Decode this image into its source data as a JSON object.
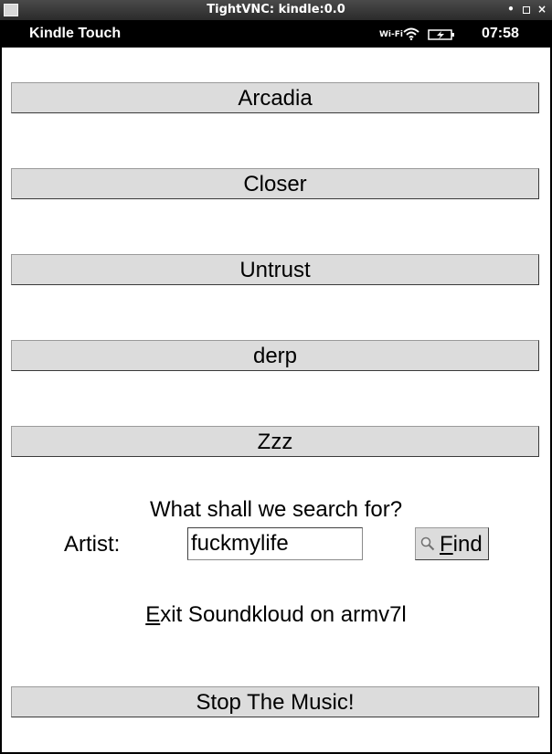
{
  "window": {
    "title": "TightVNC: kindle:0.0"
  },
  "statusbar": {
    "device": "Kindle Touch",
    "wifi_label": "Wi-Fi",
    "clock": "07:58"
  },
  "playlists": [
    {
      "label": "Arcadia"
    },
    {
      "label": "Closer"
    },
    {
      "label": "Untrust"
    },
    {
      "label": "derp"
    },
    {
      "label": "Zzz"
    }
  ],
  "search": {
    "prompt": "What shall we search for?",
    "artist_label": "Artist:",
    "value": "fuckmylife",
    "find_label": "Find"
  },
  "exit": {
    "label": "Exit Soundkloud on armv7l"
  },
  "stop": {
    "label": "Stop The Music!"
  }
}
